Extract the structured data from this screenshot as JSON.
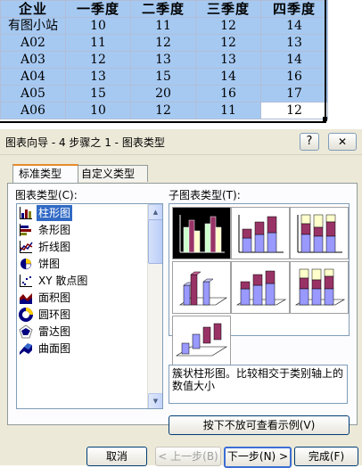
{
  "sheet": {
    "headers": [
      "企业",
      "一季度",
      "二季度",
      "三季度",
      "四季度"
    ],
    "rows": [
      [
        "有图小站",
        "10",
        "11",
        "12",
        "14"
      ],
      [
        "A02",
        "11",
        "12",
        "12",
        "13"
      ],
      [
        "A03",
        "12",
        "13",
        "13",
        "14"
      ],
      [
        "A04",
        "13",
        "15",
        "14",
        "16"
      ],
      [
        "A05",
        "15",
        "20",
        "16",
        "17"
      ],
      [
        "A06",
        "10",
        "12",
        "11",
        "12"
      ]
    ]
  },
  "dialog": {
    "title": "图表向导 - 4 步骤之 1 - 图表类型",
    "help_label": "?",
    "close_label": "✕",
    "tabs": [
      "标准类型",
      "自定义类型"
    ],
    "chart_type_label": "图表类型(C):",
    "chart_types": [
      {
        "label": "柱形图",
        "icon": "column-chart-icon"
      },
      {
        "label": "条形图",
        "icon": "bar-chart-icon"
      },
      {
        "label": "折线图",
        "icon": "line-chart-icon"
      },
      {
        "label": "饼图",
        "icon": "pie-chart-icon"
      },
      {
        "label": "XY 散点图",
        "icon": "scatter-chart-icon"
      },
      {
        "label": "面积图",
        "icon": "area-chart-icon"
      },
      {
        "label": "圆环图",
        "icon": "doughnut-chart-icon"
      },
      {
        "label": "雷达图",
        "icon": "radar-chart-icon"
      },
      {
        "label": "曲面图",
        "icon": "surface-chart-icon"
      }
    ],
    "subtype_label": "子图表类型(T):",
    "description": "簇状柱形图。比较相交于类别轴上的数值大小",
    "preview_button": "按下不放可查看示例(V)",
    "buttons": {
      "cancel": "取消",
      "back": "< 上一步(B)",
      "next": "下一步(N) >",
      "finish": "完成(F)"
    },
    "colors": {
      "selection": "#316ac5",
      "series": [
        "#9999ff",
        "#993366",
        "#ffffcc",
        "#ccffff"
      ]
    }
  }
}
